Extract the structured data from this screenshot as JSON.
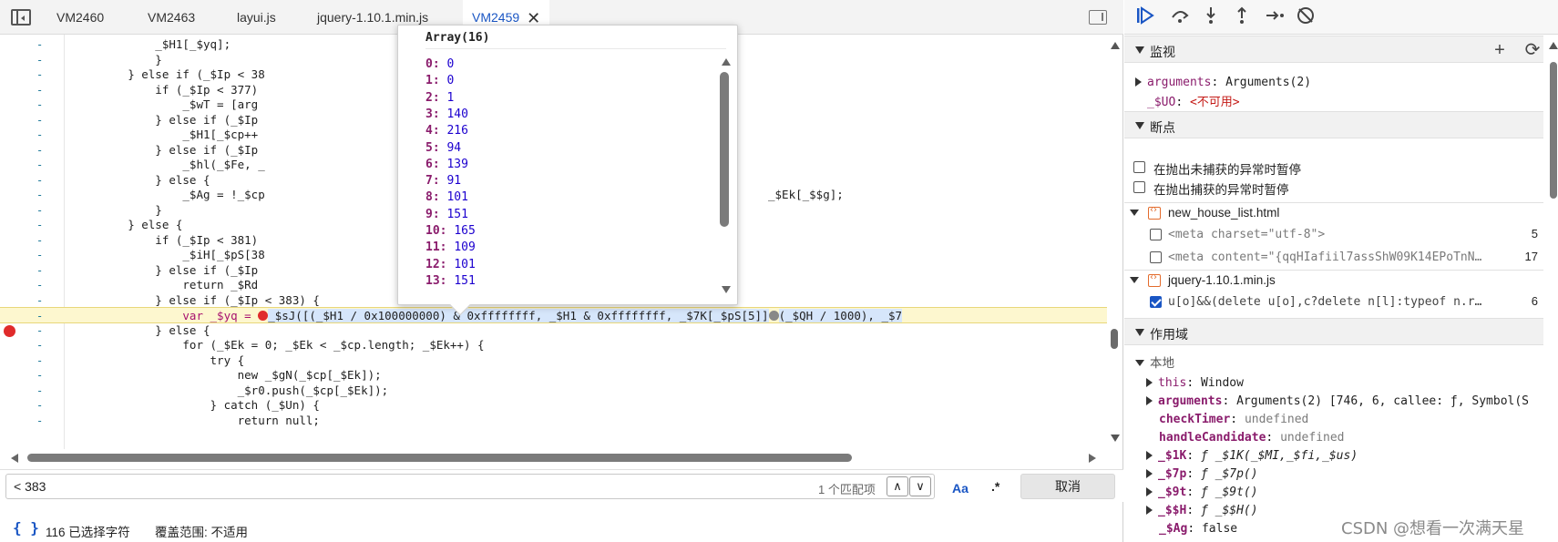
{
  "tabs": [
    {
      "label": "VM2460"
    },
    {
      "label": "VM2463"
    },
    {
      "label": "layui.js"
    },
    {
      "label": "jquery-1.10.1.min.js"
    },
    {
      "label": "VM2459",
      "close": "✕"
    }
  ],
  "code_lines": [
    {
      "dash": "-",
      "text": "            _$H1[_$yq];"
    },
    {
      "dash": "-",
      "text": "            }"
    },
    {
      "dash": "-",
      "text": "        } else if (_$Ip < 38"
    },
    {
      "dash": "-",
      "text": "            if (_$Ip < 377)"
    },
    {
      "dash": "-",
      "text": "                _$wT = [arg"
    },
    {
      "dash": "-",
      "text": "            } else if (_$Ip"
    },
    {
      "dash": "-",
      "text": "                _$H1[_$cp++"
    },
    {
      "dash": "-",
      "text": "            } else if (_$Ip"
    },
    {
      "dash": "-",
      "text": "                _$hl(_$Fe, _"
    },
    {
      "dash": "-",
      "text": "            } else {"
    },
    {
      "dash": "-",
      "text": "                _$Ag = !_$cp"
    },
    {
      "dash": "-",
      "text": "            }"
    },
    {
      "dash": "-",
      "text": "        } else {"
    },
    {
      "dash": "-",
      "text": "            if (_$Ip < 381)"
    },
    {
      "dash": "-",
      "text": "                _$iH[_$pS[38"
    },
    {
      "dash": "-",
      "text": "            } else if (_$Ip"
    },
    {
      "dash": "-",
      "text": "                return _$Rd"
    },
    {
      "dash": "-",
      "text": "            } else if (_$Ip < 383) {"
    },
    {
      "dash": "-",
      "text": "                var _$yq = "
    },
    {
      "dash": "-",
      "text": "            } else {"
    },
    {
      "dash": "-",
      "text": "                for (_$Ek = 0; _$Ek < _$cp.length; _$Ek++) {"
    },
    {
      "dash": "-",
      "text": "                    try {"
    },
    {
      "dash": "-",
      "text": "                        new _$gN(_$cp[_$Ek]);"
    },
    {
      "dash": "-",
      "text": "                        _$r0.push(_$cp[_$Ek]);"
    },
    {
      "dash": "-",
      "text": "                    } catch (_$Un) {"
    },
    {
      "dash": "-",
      "text": "                        return null;"
    }
  ],
  "code_tail_line11": "_$Ek[_$$g];",
  "current_line": {
    "prefix": "                var _$yq = ",
    "call": "_$sJ([(_$H1 / 0x100000000) & 0xffffffff, _$H1 & 0xffffffff, _$7K[_$pS[5]]",
    "suffix": "(_$QH / 1000), _$7"
  },
  "popover": {
    "title": "Array(16)",
    "items": [
      {
        "k": "0",
        "v": "0"
      },
      {
        "k": "1",
        "v": "0"
      },
      {
        "k": "2",
        "v": "1"
      },
      {
        "k": "3",
        "v": "140"
      },
      {
        "k": "4",
        "v": "216"
      },
      {
        "k": "5",
        "v": "94"
      },
      {
        "k": "6",
        "v": "139"
      },
      {
        "k": "7",
        "v": "91"
      },
      {
        "k": "8",
        "v": "101"
      },
      {
        "k": "9",
        "v": "151"
      },
      {
        "k": "10",
        "v": "165"
      },
      {
        "k": "11",
        "v": "109"
      },
      {
        "k": "12",
        "v": "101"
      },
      {
        "k": "13",
        "v": "151"
      }
    ]
  },
  "search": {
    "value": "< 383",
    "match_count": "1 个匹配项",
    "prev": "∧",
    "next": "∨",
    "case_label": "Aa",
    "regex_label": ".*",
    "cancel_label": "取消"
  },
  "status": {
    "braces": "{ }",
    "selected": "116 已选择字符",
    "coverage": "覆盖范围: 不适用"
  },
  "debugger": {
    "toolbar_icons": [
      "resume-icon",
      "step-over-icon",
      "step-into-icon",
      "step-out-icon",
      "step-icon",
      "deactivate-breakpoints-icon"
    ],
    "watch": {
      "title": "监视",
      "add": "+",
      "refresh": "⟳",
      "items": [
        {
          "name": "arguments",
          "value": "Arguments(2)"
        },
        {
          "name": "_$UO",
          "value": "<不可用>"
        }
      ]
    },
    "breakpoints": {
      "title": "断点",
      "pause_uncaught": "在抛出未捕获的异常时暂停",
      "pause_caught": "在抛出捕获的异常时暂停",
      "files": [
        {
          "name": "new_house_list.html",
          "entries": [
            {
              "code": "<meta charset=\"utf-8\">",
              "line": "5",
              "checked": false
            },
            {
              "code": "<meta content=\"{qqHIafiil7assShW09K14EPoTnN…",
              "line": "17",
              "checked": false
            }
          ]
        },
        {
          "name": "jquery-1.10.1.min.js",
          "entries": [
            {
              "code": "u[o]&&(delete u[o],c?delete n[l]:typeof n.r…",
              "line": "6",
              "checked": true
            }
          ]
        }
      ]
    },
    "scope": {
      "title": "作用域",
      "local_title": "本地",
      "this_label": "this",
      "this_value": "Window",
      "arguments_label": "arguments",
      "arguments_value": "Arguments(2) [746, 6, callee: ƒ, Symbol(S",
      "checkTimer_label": "checkTimer",
      "checkTimer_value": "undefined",
      "handleCandidate_label": "handleCandidate",
      "handleCandidate_value": "undefined",
      "vars": [
        {
          "name": "_$1K",
          "value": "ƒ _$1K(_$MI,_$fi,_$us)"
        },
        {
          "name": "_$7p",
          "value": "ƒ _$7p()"
        },
        {
          "name": "_$9t",
          "value": "ƒ _$9t()"
        },
        {
          "name": "_$$H",
          "value": "ƒ _$$H()"
        }
      ],
      "ag_label": "_$Ag",
      "ag_value": "false"
    }
  },
  "watermark": "CSDN @想看一次满天星"
}
